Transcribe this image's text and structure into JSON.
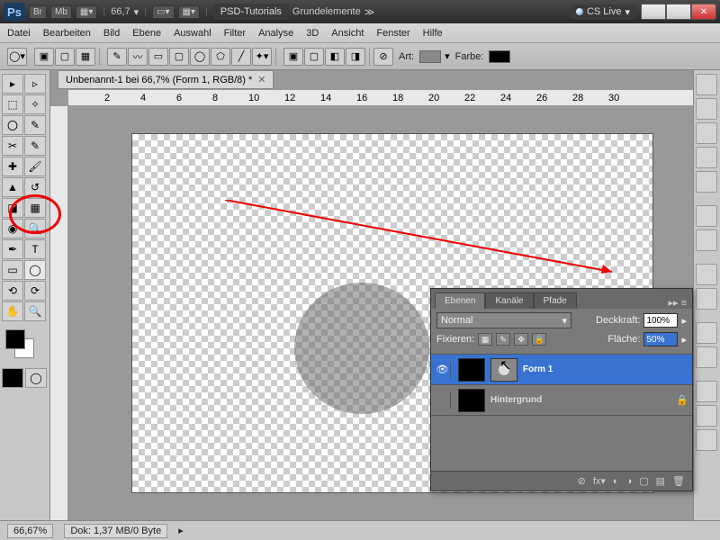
{
  "titlebar": {
    "zoom": "66,7",
    "tab": "PSD-Tutorials",
    "workspace": "Grundelemente",
    "cslive": "CS Live",
    "btn_br": "Br",
    "btn_mb": "Mb"
  },
  "menu": [
    "Datei",
    "Bearbeiten",
    "Bild",
    "Ebene",
    "Auswahl",
    "Filter",
    "Analyse",
    "3D",
    "Ansicht",
    "Fenster",
    "Hilfe"
  ],
  "optbar": {
    "art": "Art:",
    "farbe": "Farbe:"
  },
  "doc": {
    "tab": "Unbenannt-1 bei 66,7% (Form 1, RGB/8) *"
  },
  "ruler": [
    "2",
    "4",
    "6",
    "8",
    "10",
    "12",
    "14",
    "16",
    "18",
    "20",
    "22",
    "24",
    "26",
    "28",
    "30"
  ],
  "panel": {
    "tabs": {
      "ebenen": "Ebenen",
      "kanale": "Kanäle",
      "pfade": "Pfade"
    },
    "blend": "Normal",
    "deckkraft_label": "Deckkraft:",
    "deckkraft": "100%",
    "fixieren": "Fixieren:",
    "flache_label": "Fläche:",
    "flache": "50%",
    "layers": [
      {
        "name": "Form 1",
        "selected": true,
        "visible": true,
        "hasMask": true
      },
      {
        "name": "Hintergrund",
        "selected": false,
        "visible": false,
        "locked": true
      }
    ]
  },
  "status": {
    "zoom": "66,67%",
    "dok": "Dok: 1,37 MB/0 Byte"
  }
}
